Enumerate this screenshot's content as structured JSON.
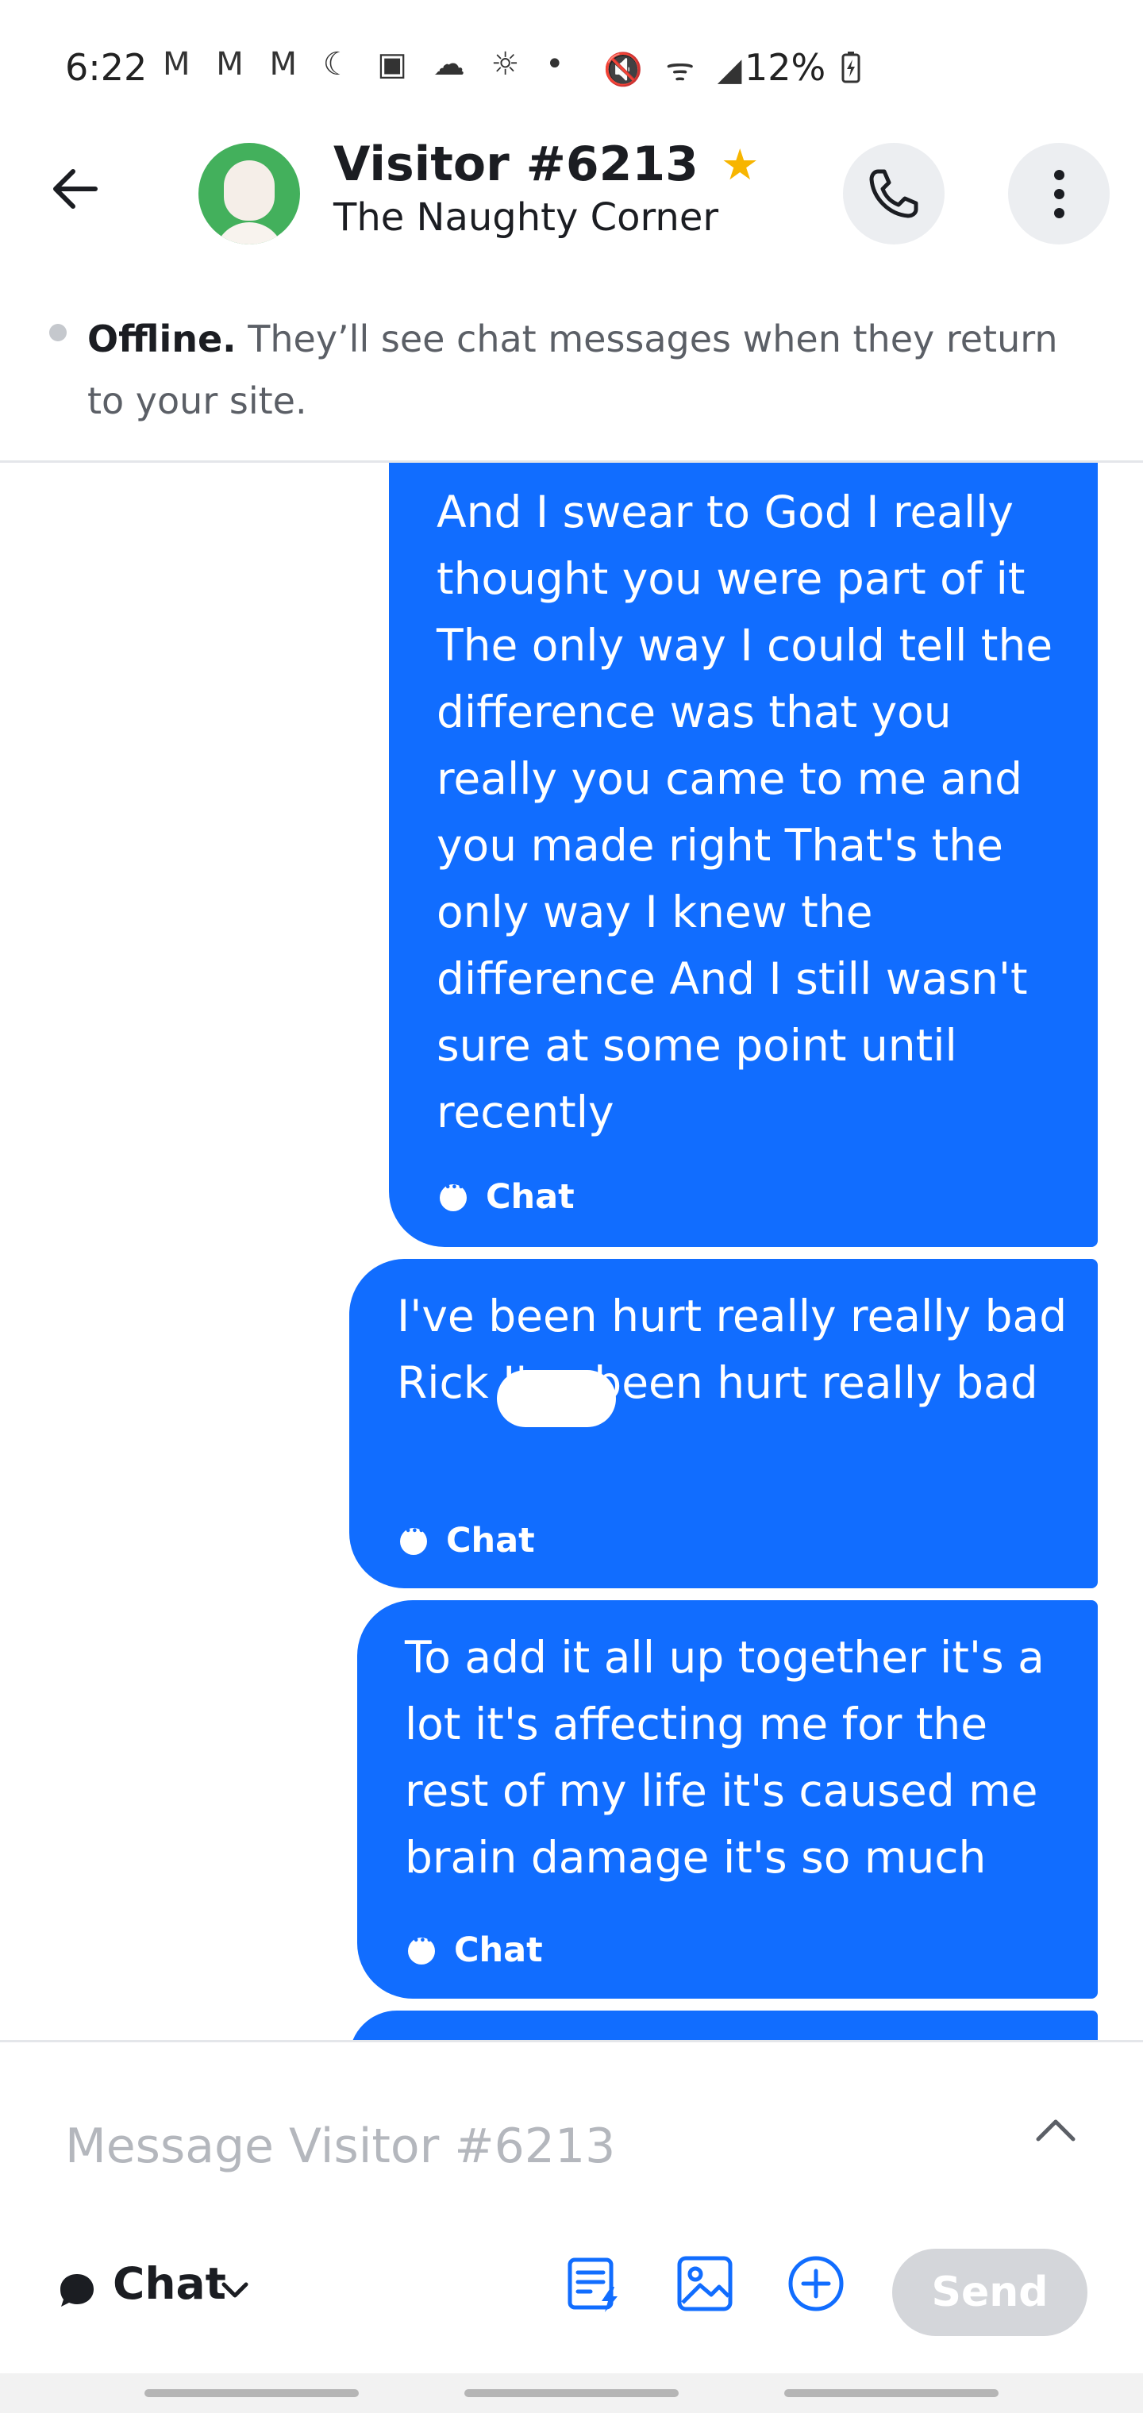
{
  "status_bar": {
    "time": "6:22",
    "left_icons": "M M M ☾ ▣ ☁ ☼ •",
    "right_icons": "🔇 ᯤ ◢",
    "battery": "12%"
  },
  "header": {
    "visitor_name": "Visitor #6213",
    "site_name": "The Naughty Corner",
    "starred": true
  },
  "notice": {
    "status": "Offline.",
    "message": "They’ll see chat messages when they return to your site."
  },
  "messages": [
    {
      "text": "And I swear to God I really thought you were part of it The only way I could tell the difference was that you really you came to me and you made right That's the only way I knew the difference And I still wasn't sure at some point until recently",
      "channel": "Chat"
    },
    {
      "text": "I've been hurt really really bad Rick I've been hurt really bad",
      "channel": "Chat"
    },
    {
      "text": "To add it all up together it's a lot it's affecting me for the rest of my life it's caused me brain damage it's so much",
      "channel": "Chat"
    }
  ],
  "composer": {
    "placeholder": "Message Visitor #6213",
    "channel": "Chat",
    "send_label": "Send"
  },
  "colors": {
    "accent": "#116dff",
    "star": "#f7b500",
    "avatar_bg": "#43b05c"
  }
}
